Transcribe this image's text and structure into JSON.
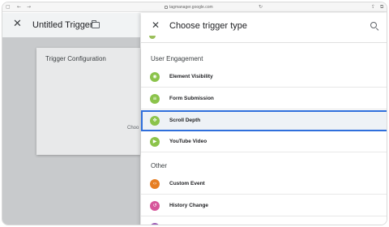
{
  "browser": {
    "url": "tagmanager.google.com",
    "back_glyph": "←",
    "forward_glyph": "→",
    "reload_glyph": "↻",
    "sidebar_glyph": "▢",
    "share_glyph": "⇪",
    "tabs_glyph": "⧉"
  },
  "left_app": {
    "close_glyph": "✕",
    "title": "Untitled Trigger",
    "card_title": "Trigger Configuration",
    "card_hint": "Choo"
  },
  "panel": {
    "close_glyph": "✕",
    "title": "Choose trigger type",
    "sections": [
      {
        "title": "User Engagement",
        "items": [
          {
            "label": "Element Visibility",
            "icon": "eye-icon",
            "icon_glyph": "◉",
            "color": "#8bc34a"
          },
          {
            "label": "Form Submission",
            "icon": "form-icon",
            "icon_glyph": "≡",
            "color": "#8bc34a"
          },
          {
            "label": "Scroll Depth",
            "icon": "scroll-icon",
            "icon_glyph": "✥",
            "color": "#8bc34a",
            "selected": true
          },
          {
            "label": "YouTube Video",
            "icon": "play-icon",
            "icon_glyph": "▶",
            "color": "#8bc34a"
          }
        ]
      },
      {
        "title": "Other",
        "items": [
          {
            "label": "Custom Event",
            "icon": "code-icon",
            "icon_glyph": "‹›",
            "color": "#e67e22"
          },
          {
            "label": "History Change",
            "icon": "history-icon",
            "icon_glyph": "↺",
            "color": "#d6559a"
          }
        ]
      }
    ]
  },
  "colors": {
    "selection_border": "#2f6fdc",
    "engagement_icon": "#8bc34a",
    "custom_event_icon": "#e67e22",
    "history_icon": "#d6559a"
  }
}
